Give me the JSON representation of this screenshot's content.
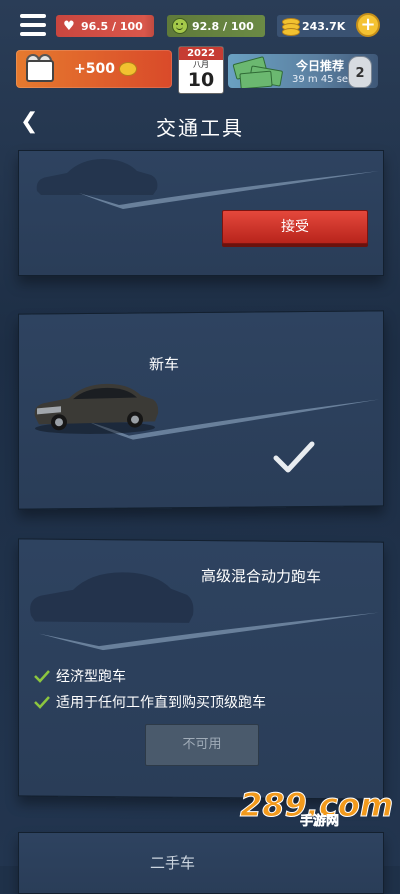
{
  "stats": {
    "health": "96.5 / 100",
    "mood": "92.8 / 100",
    "money": "243.7K"
  },
  "bonus": {
    "amount": "+500"
  },
  "calendar": {
    "year": "2022",
    "month": "八月",
    "day": "10"
  },
  "daily": {
    "title": "今日推荐",
    "timer": "39 m 45 sec",
    "bag_label": "2"
  },
  "header": {
    "title": "交通工具"
  },
  "vehicles": [
    {
      "title": "",
      "action_label": "接受"
    },
    {
      "title": "新车"
    },
    {
      "title": "高级混合动力跑车",
      "features": [
        "经济型跑车",
        "适用于任何工作直到购买顶级跑车"
      ],
      "action_label": "不可用"
    },
    {
      "title": "二手车"
    }
  ],
  "watermark": {
    "main": "289.com",
    "sub": "手游网"
  },
  "colors": {
    "background": "#1f3149",
    "accept_red": "#d2382e",
    "check_green": "#8cc63f",
    "health_red": "#d9574b",
    "mood_green": "#6b8a45"
  },
  "icons": [
    "menu-icon",
    "heart-icon",
    "smile-icon",
    "coins-icon",
    "plus-icon",
    "back-icon",
    "checkmark-icon",
    "tick-icon"
  ]
}
